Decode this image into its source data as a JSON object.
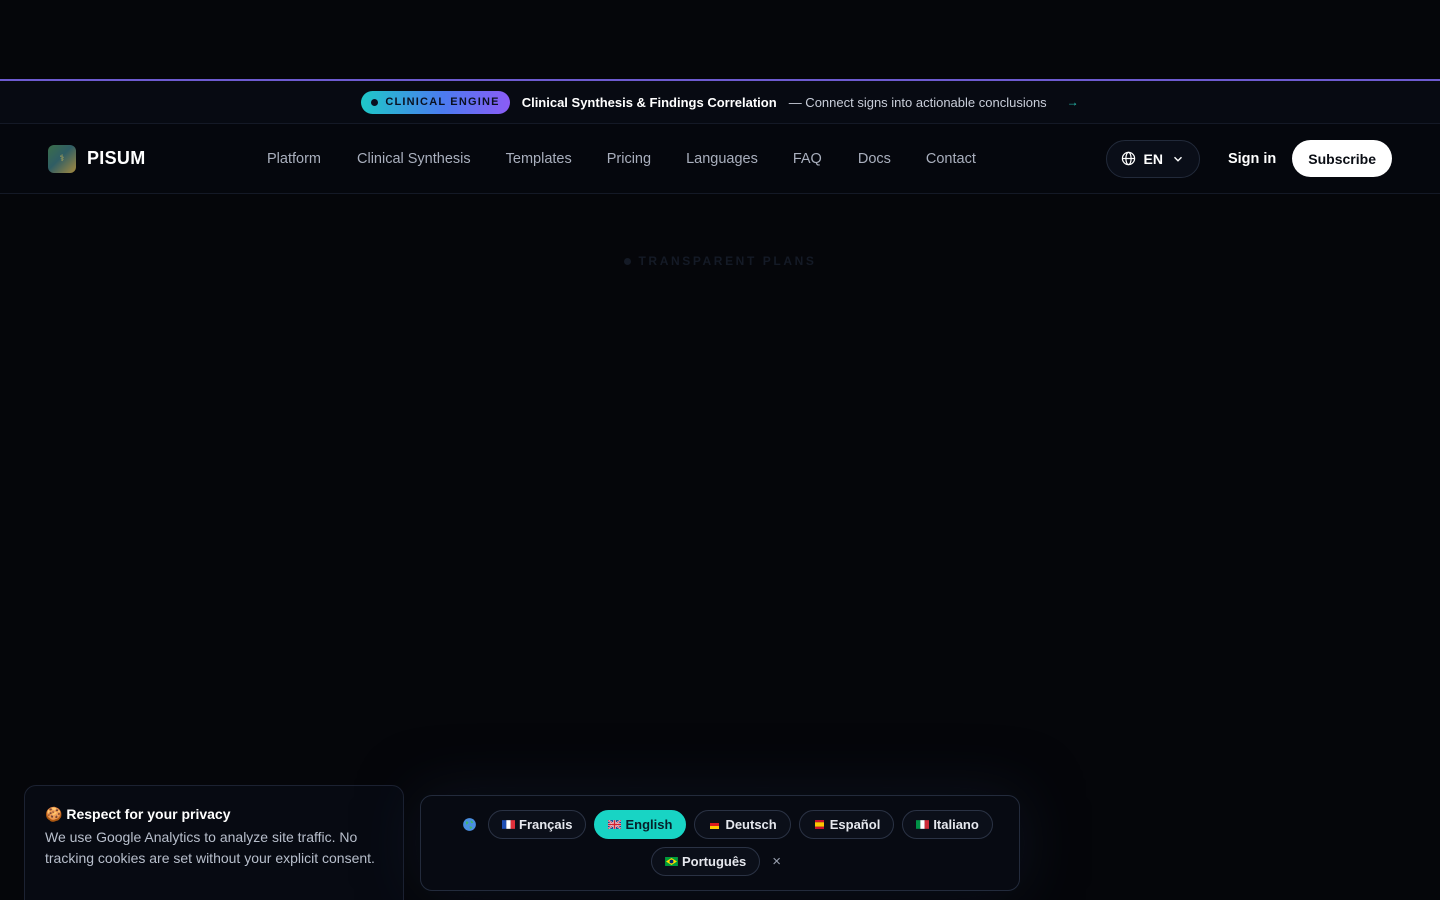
{
  "announcement": {
    "badge": "CLINICAL ENGINE",
    "title": "Clinical Synthesis & Findings Correlation",
    "description": "— Connect signs into actionable conclusions",
    "arrow": "→"
  },
  "brand": {
    "name": "PISUM",
    "logo_glyph": "⚕"
  },
  "nav": {
    "links": [
      "Platform",
      "Clinical Synthesis",
      "Templates",
      "Pricing",
      "Languages",
      "FAQ",
      "Docs",
      "Contact"
    ],
    "language": "EN",
    "signin": "Sign in",
    "subscribe": "Subscribe"
  },
  "hero": {
    "label": "TRANSPARENT PLANS"
  },
  "cookie": {
    "icon": "🍪",
    "title": "Respect for your privacy",
    "text": "We use Google Analytics to analyze site traffic. No tracking cookies are set without your explicit consent."
  },
  "language_bar": {
    "icon": "globe-icon",
    "options": [
      {
        "label": "Français",
        "flag": "fr",
        "active": false
      },
      {
        "label": "English",
        "flag": "gb",
        "active": true
      },
      {
        "label": "Deutsch",
        "flag": "de",
        "active": false
      },
      {
        "label": "Español",
        "flag": "es",
        "active": false
      },
      {
        "label": "Italiano",
        "flag": "it",
        "active": false
      },
      {
        "label": "Português",
        "flag": "br",
        "active": false
      }
    ],
    "close": "×"
  },
  "colors": {
    "accent": "#18d4c4",
    "background": "#05060a",
    "divider": "#6d5bd0"
  }
}
